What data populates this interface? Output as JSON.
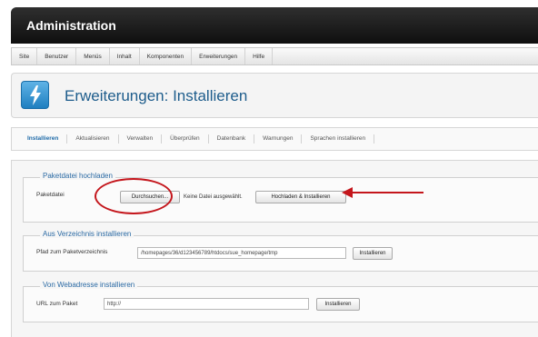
{
  "window": {
    "title": "Administration"
  },
  "menu": {
    "items": [
      "Site",
      "Benutzer",
      "Menüs",
      "Inhalt",
      "Komponenten",
      "Erweiterungen",
      "Hilfe"
    ]
  },
  "header": {
    "title": "Erweiterungen: Installieren",
    "icon": "lightning-icon"
  },
  "tabs": [
    {
      "label": "Installieren",
      "active": true
    },
    {
      "label": "Aktualisieren",
      "active": false
    },
    {
      "label": "Verwalten",
      "active": false
    },
    {
      "label": "Überprüfen",
      "active": false
    },
    {
      "label": "Datenbank",
      "active": false
    },
    {
      "label": "Warnungen",
      "active": false
    },
    {
      "label": "Sprachen installieren",
      "active": false
    }
  ],
  "upload": {
    "legend": "Paketdatei hochladen",
    "label": "Paketdatei",
    "browse_button": "Durchsuchen...",
    "no_file_text": "Keine Datei ausgewählt.",
    "submit_button": "Hochladen & Installieren"
  },
  "directory": {
    "legend": "Aus Verzeichnis installieren",
    "label": "Pfad zum Paketverzeichnis",
    "value": "/homepages/36/d123456789/htdocs/sue_homepage/tmp",
    "button": "Installieren"
  },
  "url": {
    "legend": "Von Webadresse installieren",
    "label": "URL zum Paket",
    "value": "http://",
    "button": "Installieren"
  },
  "colors": {
    "annotation": "#c4161c",
    "accent": "#1e5d8c"
  }
}
